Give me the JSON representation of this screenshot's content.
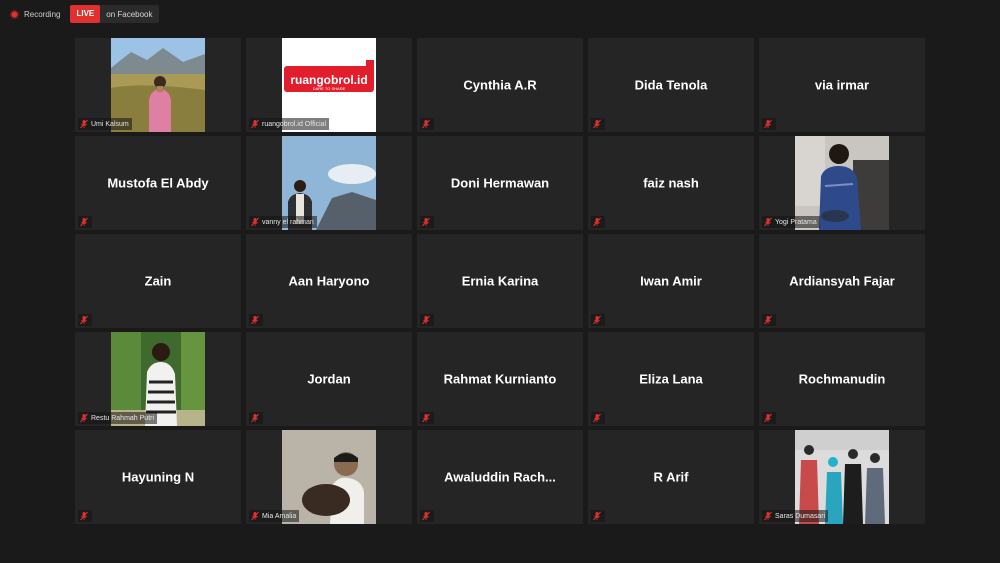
{
  "topbar": {
    "recording_label": "Recording",
    "live_label": "LIVE",
    "live_destination": "on Facebook"
  },
  "colors": {
    "background": "#1a1a1a",
    "tile": "#252525",
    "accent_red": "#e0312e"
  },
  "participants": [
    {
      "name": "Umi Kalsum",
      "video": true
    },
    {
      "name": "ruangobrol.id Official",
      "video": true,
      "logo_text": "ruangobrol.id",
      "logo_tagline": "DARE TO SHARE"
    },
    {
      "name": "Cynthia A.R",
      "video": false
    },
    {
      "name": "Dida Tenola",
      "video": false
    },
    {
      "name": "via irmar",
      "video": false
    },
    {
      "name": "Mustofa El Abdy",
      "video": false
    },
    {
      "name": "vanny el rahman",
      "video": true
    },
    {
      "name": "Doni Hermawan",
      "video": false
    },
    {
      "name": "faiz nash",
      "video": false
    },
    {
      "name": "Yogi Pratama",
      "video": true
    },
    {
      "name": "Zain",
      "video": false
    },
    {
      "name": "Aan Haryono",
      "video": false
    },
    {
      "name": "Ernia Karina",
      "video": false
    },
    {
      "name": "Iwan Amir",
      "video": false
    },
    {
      "name": "Ardiansyah Fajar",
      "video": false
    },
    {
      "name": "Restu Rahmah Putri",
      "video": true
    },
    {
      "name": "Jordan",
      "video": false
    },
    {
      "name": "Rahmat Kurnianto",
      "video": false
    },
    {
      "name": "Eliza Lana",
      "video": false
    },
    {
      "name": "Rochmanudin",
      "video": false
    },
    {
      "name": "Hayuning N",
      "video": false
    },
    {
      "name": "Mia Amalia",
      "video": true
    },
    {
      "name": "Awaluddin  Rach...",
      "video": false
    },
    {
      "name": "R Arif",
      "video": false
    },
    {
      "name": "Saras Dumasari",
      "video": true
    }
  ]
}
